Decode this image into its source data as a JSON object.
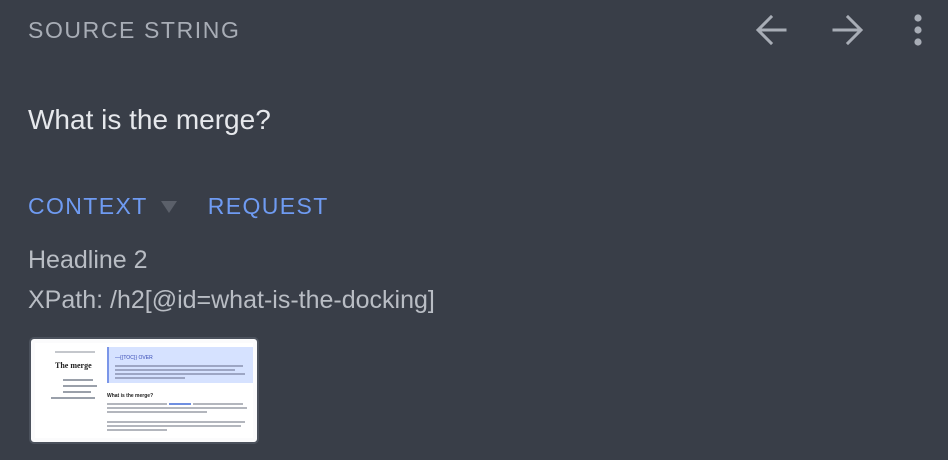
{
  "header": {
    "label": "SOURCE STRING",
    "back_icon": "arrow-left-icon",
    "forward_icon": "arrow-right-icon",
    "more_icon": "more-vertical-icon"
  },
  "source": {
    "text": "What is the merge?"
  },
  "tabs": [
    {
      "label": "CONTEXT",
      "has_dropdown": true
    },
    {
      "label": "REQUEST"
    }
  ],
  "context": {
    "headline": "Headline 2",
    "xpath": "XPath: /h2[@id=what-is-the-docking]"
  },
  "thumbnail": {
    "title": "The merge",
    "callout_title": "—{{TOC}} OVER",
    "section_heading": "What is the merge?"
  },
  "colors": {
    "background": "#393e48",
    "accent": "#6f9bf2",
    "header_text": "#a8adb6",
    "primary_text": "#e6e8ec",
    "secondary_text": "#b9bdc4"
  }
}
